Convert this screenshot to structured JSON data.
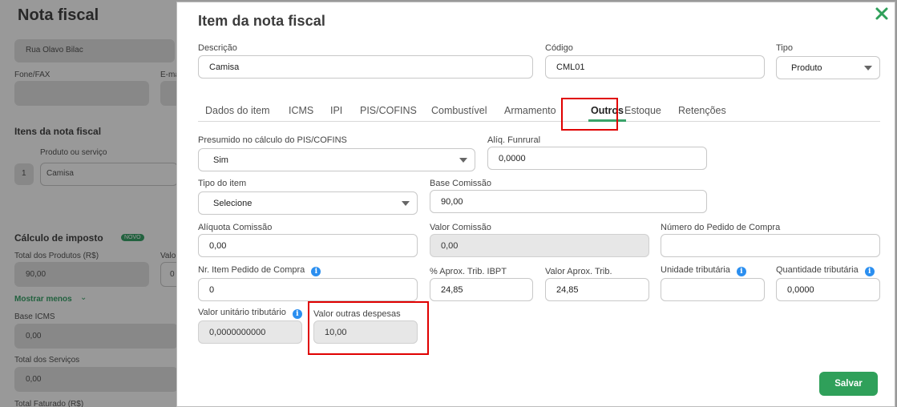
{
  "background": {
    "page_title": "Nota fiscal",
    "address_value": "Rua Olavo Bilac",
    "fone_label": "Fone/FAX",
    "email_label": "E-mail",
    "items_heading": "Itens da nota fiscal",
    "product_label": "Produto ou serviço",
    "row_number": "1",
    "row_product": "Camisa",
    "tax_heading": "Cálculo de imposto",
    "tax_badge": "NOVO",
    "total_produtos_label": "Total dos Produtos (R$)",
    "total_produtos_value": "90,00",
    "value_label_cut": "Valo",
    "value_cut": "0",
    "show_less": "Mostrar menos",
    "base_icms_label": "Base ICMS",
    "base_icms_value": "0,00",
    "total_servicos_label": "Total dos Serviços",
    "total_servicos_value": "0,00",
    "total_faturado_label": "Total Faturado (R$)"
  },
  "modal": {
    "title": "Item da nota fiscal",
    "descricao": {
      "label": "Descrição",
      "value": "Camisa"
    },
    "codigo": {
      "label": "Código",
      "value": "CML01"
    },
    "tipo": {
      "label": "Tipo",
      "value": "Produto"
    },
    "tabs": [
      "Dados do item",
      "ICMS",
      "IPI",
      "PIS/COFINS",
      "Combustível",
      "Armamento",
      "Outros",
      "Estoque",
      "Retenções"
    ],
    "active_tab": "Outros",
    "fields": {
      "presumido": {
        "label": "Presumido no cálculo do PIS/COFINS",
        "value": "Sim"
      },
      "aliq_funrural": {
        "label": "Alíq. Funrural",
        "value": "0,0000"
      },
      "tipo_item": {
        "label": "Tipo do item",
        "value": "Selecione"
      },
      "base_comissao": {
        "label": "Base Comissão",
        "value": "90,00"
      },
      "aliquota_comissao": {
        "label": "Alíquota Comissão",
        "value": "0,00"
      },
      "valor_comissao": {
        "label": "Valor Comissão",
        "value": "0,00"
      },
      "numero_pedido": {
        "label": "Número do Pedido de Compra",
        "value": ""
      },
      "nr_item_pedido": {
        "label": "Nr. Item Pedido de Compra",
        "value": "0"
      },
      "aprox_trib_ibpt": {
        "label": "% Aprox. Trib. IBPT",
        "value": "24,85"
      },
      "valor_aprox_trib": {
        "label": "Valor Aprox. Trib.",
        "value": "24,85"
      },
      "unidade_tributaria": {
        "label": "Unidade tributária",
        "value": ""
      },
      "quantidade_tributaria": {
        "label": "Quantidade tributária",
        "value": "0,0000"
      },
      "valor_unitario_tributario": {
        "label": "Valor unitário tributário",
        "value": "0,0000000000"
      },
      "valor_outras_despesas": {
        "label": "Valor outras despesas",
        "value": "10,00"
      }
    },
    "save_label": "Salvar"
  },
  "colors": {
    "accent_green": "#2fa05a",
    "tab_underline": "#3aa36a",
    "highlight_red": "#e00000",
    "info_blue": "#2b8ff0"
  },
  "icons": [
    "close-icon",
    "chevron-down-icon",
    "info-icon"
  ]
}
